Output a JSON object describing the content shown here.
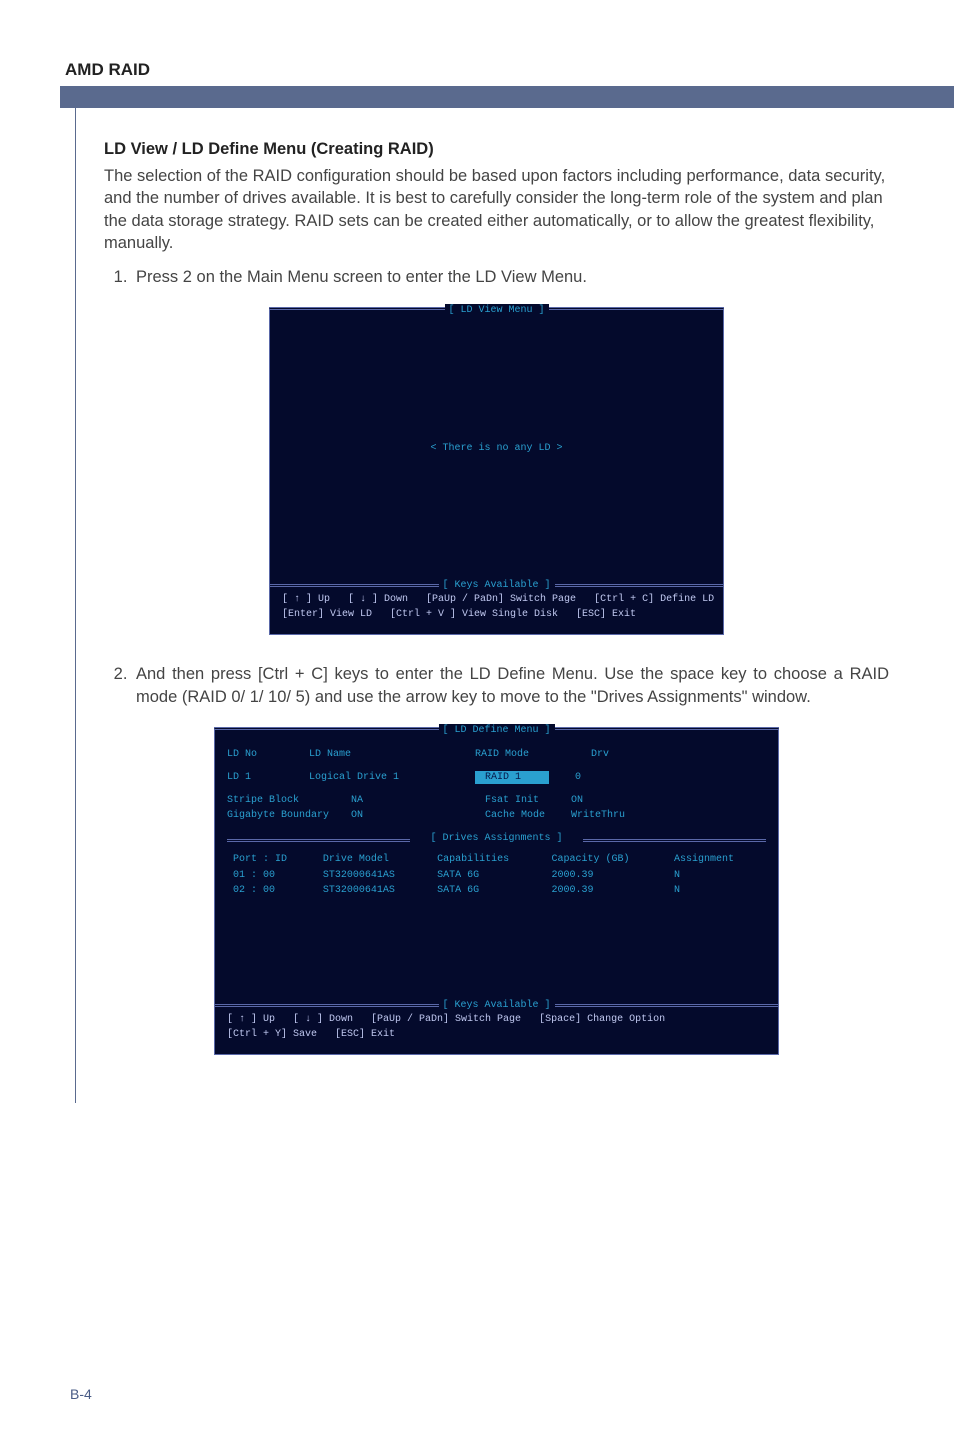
{
  "header": {
    "title": "AMD RAID"
  },
  "section": {
    "title": "LD View / LD Define Menu (Creating RAID)",
    "intro": "The selection of the RAID configuration should be based upon factors including performance, data security, and the number of drives available. It is best to carefully consider the long-term role of the system and plan the data storage strategy. RAID sets can be created either automatically, or to allow the greatest flexibility, manually."
  },
  "steps": {
    "one": "Press 2 on the Main Menu screen to enter the LD View Menu.",
    "two": "And then press [Ctrl + C] keys to enter the LD Define Menu. Use the space key to choose a RAID mode (RAID 0/ 1/ 10/ 5) and use the arrow key to move to the \"Drives Assignments\" window."
  },
  "bios1": {
    "frame_title": "[  LD View Menu  ]",
    "empty_msg": "< There is no any LD >",
    "footer_title": "[ Keys Available ]",
    "footer_lines": [
      [
        "[ ↑ ] Up",
        "[ ↓ ] Down",
        "[PaUp / PaDn]  Switch Page",
        "[Ctrl + C]  Define LD"
      ],
      [
        "[Enter]  View LD",
        "[Ctrl + V ]  View Single Disk",
        "[ESC]  Exit"
      ]
    ]
  },
  "bios2": {
    "frame_title": "[  LD Define Menu  ]",
    "ld_no_label": "LD No",
    "ld_name_label": "LD Name",
    "raid_mode_label": "RAID Mode",
    "drv_label": "Drv",
    "ld_no_val": "LD    1",
    "ld_name_val": "Logical Drive 1",
    "raid_mode_val": "RAID 1",
    "drv_val": "0",
    "stripe_block_label": "Stripe Block",
    "stripe_block_val": "NA",
    "fsat_init_label": "Fsat Init",
    "fsat_init_val": "ON",
    "gig_boundary_label": "Gigabyte Boundary",
    "gig_boundary_val": "ON",
    "cache_mode_label": "Cache Mode",
    "cache_mode_val": "WriteThru",
    "drives_title": "[  Drives Assignments  ]",
    "table": {
      "headers": [
        "Port : ID",
        "Drive Model",
        "Capabilities",
        "Capacity (GB)",
        "Assignment"
      ],
      "rows": [
        [
          "01 : 00",
          "ST32000641AS",
          "SATA 6G",
          "2000.39",
          "N"
        ],
        [
          "02 : 00",
          "ST32000641AS",
          "SATA 6G",
          "2000.39",
          "N"
        ]
      ]
    },
    "footer_title": "[ Keys Available ]",
    "footer_lines": [
      [
        "[ ↑ ] Up",
        "[ ↓ ] Down",
        "[PaUp / PaDn]  Switch Page",
        "[Space]  Change Option"
      ],
      [
        "[Ctrl + Y]  Save",
        "[ESC]  Exit"
      ]
    ]
  },
  "page_num": "B-4"
}
